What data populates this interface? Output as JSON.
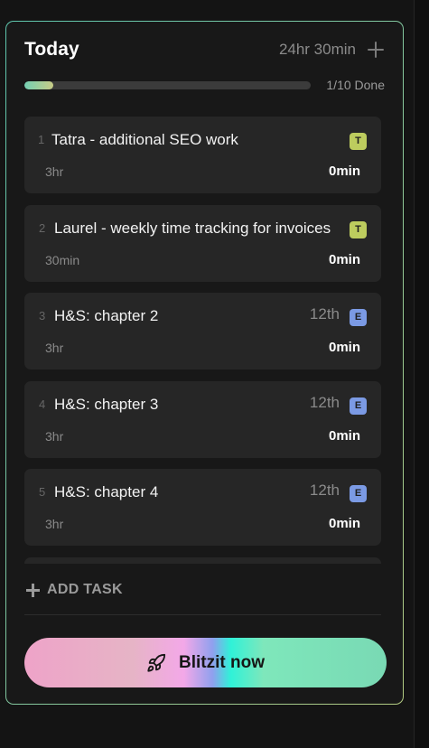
{
  "header": {
    "title": "Today",
    "total_time": "24hr 30min"
  },
  "progress": {
    "fraction": 0.1,
    "label": "1/10 Done"
  },
  "tasks": [
    {
      "num": "1",
      "name": "Tatra - additional SEO work",
      "date": "",
      "badge": "T",
      "badge_color": "#bdcc5e",
      "estimate": "3hr",
      "spent": "0min"
    },
    {
      "num": "2",
      "name": "Laurel - weekly time tracking for invoices",
      "date": "",
      "badge": "T",
      "badge_color": "#bdcc5e",
      "estimate": "30min",
      "spent": "0min"
    },
    {
      "num": "3",
      "name": "H&S: chapter 2",
      "date": "12th",
      "badge": "E",
      "badge_color": "#7b9ae4",
      "estimate": "3hr",
      "spent": "0min"
    },
    {
      "num": "4",
      "name": "H&S: chapter 3",
      "date": "12th",
      "badge": "E",
      "badge_color": "#7b9ae4",
      "estimate": "3hr",
      "spent": "0min"
    },
    {
      "num": "5",
      "name": "H&S: chapter 4",
      "date": "12th",
      "badge": "E",
      "badge_color": "#7b9ae4",
      "estimate": "3hr",
      "spent": "0min"
    }
  ],
  "add_task": {
    "label": "ADD TASK"
  },
  "blitz_button": {
    "label": "Blitzit now"
  },
  "icons": {
    "add": "plus-icon",
    "blitz": "rocket-icon"
  }
}
